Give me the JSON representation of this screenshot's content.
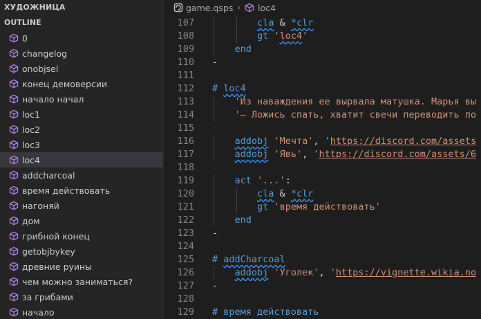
{
  "sidebar": {
    "title": "ХУДОЖНИЦА",
    "section": "OUTLINE",
    "items": [
      {
        "label": "0"
      },
      {
        "label": "changelog"
      },
      {
        "label": "onobjsel"
      },
      {
        "label": "конец демоверсии"
      },
      {
        "label": "начало начал"
      },
      {
        "label": "loc1"
      },
      {
        "label": "loc2"
      },
      {
        "label": "loc3"
      },
      {
        "label": "loc4",
        "selected": true
      },
      {
        "label": "addcharcoal"
      },
      {
        "label": "время действовать"
      },
      {
        "label": "нагоняй"
      },
      {
        "label": "дом"
      },
      {
        "label": "грибной конец"
      },
      {
        "label": "getobjbykey"
      },
      {
        "label": "древние руины"
      },
      {
        "label": "чем можно заниматься?"
      },
      {
        "label": "за грибами"
      },
      {
        "label": "начало"
      }
    ]
  },
  "breadcrumb": {
    "file": "game.qsps",
    "symbol": "loc4"
  },
  "editor": {
    "lines": [
      {
        "num": "107",
        "tokens": [
          {
            "t": "        "
          },
          {
            "t": "cla",
            "c": "kw wavy"
          },
          {
            "t": " & "
          },
          {
            "t": "*clr",
            "c": "kw wavy"
          }
        ]
      },
      {
        "num": "108",
        "tokens": [
          {
            "t": "        "
          },
          {
            "t": "gt",
            "c": "kw"
          },
          {
            "t": " "
          },
          {
            "t": "'",
            "c": "str"
          },
          {
            "t": "loc4",
            "c": "str wavy"
          },
          {
            "t": "'",
            "c": "str"
          }
        ]
      },
      {
        "num": "109",
        "tokens": [
          {
            "t": "    "
          },
          {
            "t": "end",
            "c": "kw"
          }
        ]
      },
      {
        "num": "110",
        "tokens": [
          {
            "t": "-",
            "c": "mark"
          }
        ]
      },
      {
        "num": "111",
        "tokens": []
      },
      {
        "num": "112",
        "tokens": [
          {
            "t": "# ",
            "c": "kw"
          },
          {
            "t": "loc4",
            "c": "kw wavy"
          }
        ]
      },
      {
        "num": "113",
        "tokens": [
          {
            "t": "    "
          },
          {
            "t": "'Из наваждения ее вырвала матушка. Марья вы",
            "c": "str"
          }
        ]
      },
      {
        "num": "114",
        "tokens": [
          {
            "t": "    "
          },
          {
            "t": "'— Ложись спать, хватит свечи переводить по",
            "c": "str"
          }
        ]
      },
      {
        "num": "115",
        "tokens": []
      },
      {
        "num": "116",
        "tokens": [
          {
            "t": "    "
          },
          {
            "t": "addobj",
            "c": "kw wavy"
          },
          {
            "t": " "
          },
          {
            "t": "'Мечта'",
            "c": "str"
          },
          {
            "t": ", "
          },
          {
            "t": "'",
            "c": "str"
          },
          {
            "t": "https://discord.com/assets",
            "c": "url"
          }
        ]
      },
      {
        "num": "117",
        "tokens": [
          {
            "t": "    "
          },
          {
            "t": "addobj",
            "c": "kw wavy"
          },
          {
            "t": " "
          },
          {
            "t": "'Явь'",
            "c": "str"
          },
          {
            "t": ", "
          },
          {
            "t": "'",
            "c": "str"
          },
          {
            "t": "https://discord.com/assets/6",
            "c": "url"
          }
        ]
      },
      {
        "num": "118",
        "tokens": []
      },
      {
        "num": "119",
        "tokens": [
          {
            "t": "    "
          },
          {
            "t": "act",
            "c": "kw"
          },
          {
            "t": " "
          },
          {
            "t": "'...'",
            "c": "str"
          },
          {
            "t": ":"
          }
        ]
      },
      {
        "num": "120",
        "tokens": [
          {
            "t": "        "
          },
          {
            "t": "cla",
            "c": "kw wavy"
          },
          {
            "t": " & "
          },
          {
            "t": "*clr",
            "c": "kw wavy"
          }
        ]
      },
      {
        "num": "121",
        "tokens": [
          {
            "t": "        "
          },
          {
            "t": "gt",
            "c": "kw"
          },
          {
            "t": " "
          },
          {
            "t": "'время действовать'",
            "c": "str"
          }
        ]
      },
      {
        "num": "122",
        "tokens": [
          {
            "t": "    "
          },
          {
            "t": "end",
            "c": "kw"
          }
        ]
      },
      {
        "num": "123",
        "tokens": [
          {
            "t": "-",
            "c": "mark"
          }
        ]
      },
      {
        "num": "124",
        "tokens": []
      },
      {
        "num": "125",
        "tokens": [
          {
            "t": "# ",
            "c": "kw"
          },
          {
            "t": "addCharcoal",
            "c": "kw wavy"
          }
        ]
      },
      {
        "num": "126",
        "tokens": [
          {
            "t": "    "
          },
          {
            "t": "addobj",
            "c": "kw wavy"
          },
          {
            "t": " "
          },
          {
            "t": "'Уголек'",
            "c": "str"
          },
          {
            "t": ", "
          },
          {
            "t": "'",
            "c": "str"
          },
          {
            "t": "https://vignette.wikia.no",
            "c": "url"
          }
        ]
      },
      {
        "num": "127",
        "tokens": [
          {
            "t": "-",
            "c": "mark"
          }
        ]
      },
      {
        "num": "128",
        "tokens": []
      },
      {
        "num": "129",
        "tokens": [
          {
            "t": "# ",
            "c": "kw"
          },
          {
            "t": "время действовать",
            "c": "kw"
          }
        ]
      }
    ]
  },
  "colors": {
    "keyword": "#569cd6",
    "string": "#ce9178",
    "cube_icon": "#b180d7",
    "selection": "#37373d"
  }
}
